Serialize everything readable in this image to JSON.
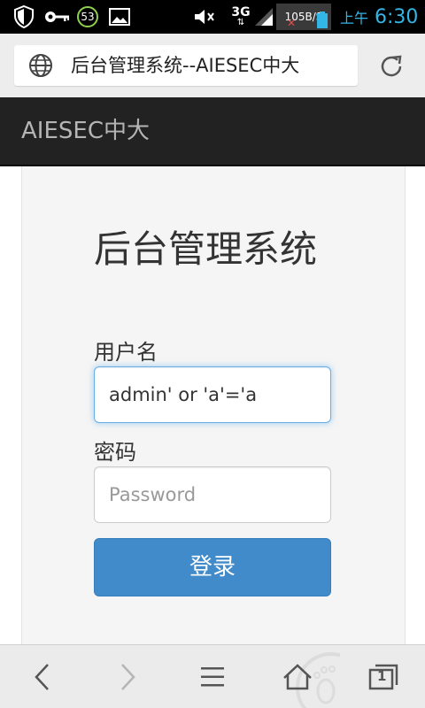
{
  "status_bar": {
    "notification_count": "53",
    "network_type": "3G",
    "network_speed": "105B/S",
    "am_pm": "上午",
    "time": "6:30"
  },
  "browser": {
    "page_title": "后台管理系统--AIESEC中大",
    "toolbar_icons": [
      "back-icon",
      "forward-icon",
      "menu-icon",
      "home-icon",
      "tabs-icon"
    ],
    "tab_count": "1"
  },
  "site": {
    "brand": "AIESEC中大"
  },
  "login_form": {
    "title": "后台管理系统",
    "username_label": "用户名",
    "username_value": "admin' or 'a'='a",
    "password_label": "密码",
    "password_placeholder": "Password",
    "submit_label": "登录"
  },
  "colors": {
    "navbar_bg": "#222222",
    "primary_button": "#428bca",
    "focus_border": "#66afe9",
    "status_accent": "#33b5e5"
  }
}
